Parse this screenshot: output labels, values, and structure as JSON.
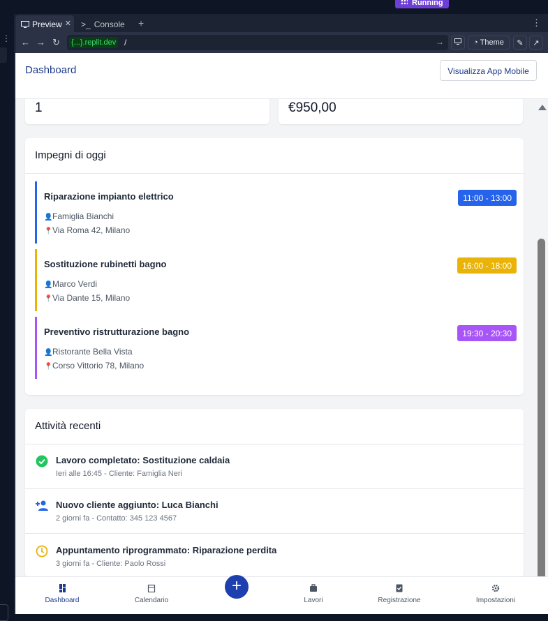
{
  "ide": {
    "running_label": "Running",
    "tabs": [
      {
        "label": "Preview"
      },
      {
        "label": "Console"
      }
    ],
    "url": {
      "domain": "{...}.replit.dev",
      "path": "/"
    },
    "theme_label": "Theme"
  },
  "app": {
    "header_title": "Dashboard",
    "mobile_button": "Visualizza App Mobile",
    "stats": [
      {
        "value": "1"
      },
      {
        "value": "€950,00"
      }
    ],
    "today": {
      "title": "Impegni di oggi",
      "items": [
        {
          "title": "Riparazione impianto elettrico",
          "client": "Famiglia Bianchi",
          "address": "Via Roma 42, Milano",
          "time": "11:00 - 13:00",
          "color": "#2563eb"
        },
        {
          "title": "Sostituzione rubinetti bagno",
          "client": "Marco Verdi",
          "address": "Via Dante 15, Milano",
          "time": "16:00 - 18:00",
          "color": "#eab308"
        },
        {
          "title": "Preventivo ristrutturazione bagno",
          "client": "Ristorante Bella Vista",
          "address": "Corso Vittorio 78, Milano",
          "time": "19:30 - 20:30",
          "color": "#a855f7"
        }
      ]
    },
    "recent": {
      "title": "Attività recenti",
      "items": [
        {
          "title": "Lavoro completato: Sostituzione caldaia",
          "sub": "Ieri alle 16:45 - Cliente: Famiglia Neri",
          "icon": "check-circle-icon",
          "color": "#22c55e"
        },
        {
          "title": "Nuovo cliente aggiunto: Luca Bianchi",
          "sub": "2 giorni fa - Contatto: 345 123 4567",
          "icon": "person-add-icon",
          "color": "#2563eb"
        },
        {
          "title": "Appuntamento riprogrammato: Riparazione perdita",
          "sub": "3 giorni fa - Cliente: Paolo Rossi",
          "icon": "clock-icon",
          "color": "#eab308"
        }
      ]
    },
    "nav": [
      {
        "label": "Dashboard",
        "icon": "dashboard-icon"
      },
      {
        "label": "Calendario",
        "icon": "calendar-icon"
      },
      {
        "label": "Lavori",
        "icon": "briefcase-icon"
      },
      {
        "label": "Registrazione",
        "icon": "clipboard-check-icon"
      },
      {
        "label": "Impostazioni",
        "icon": "gear-icon"
      }
    ]
  }
}
